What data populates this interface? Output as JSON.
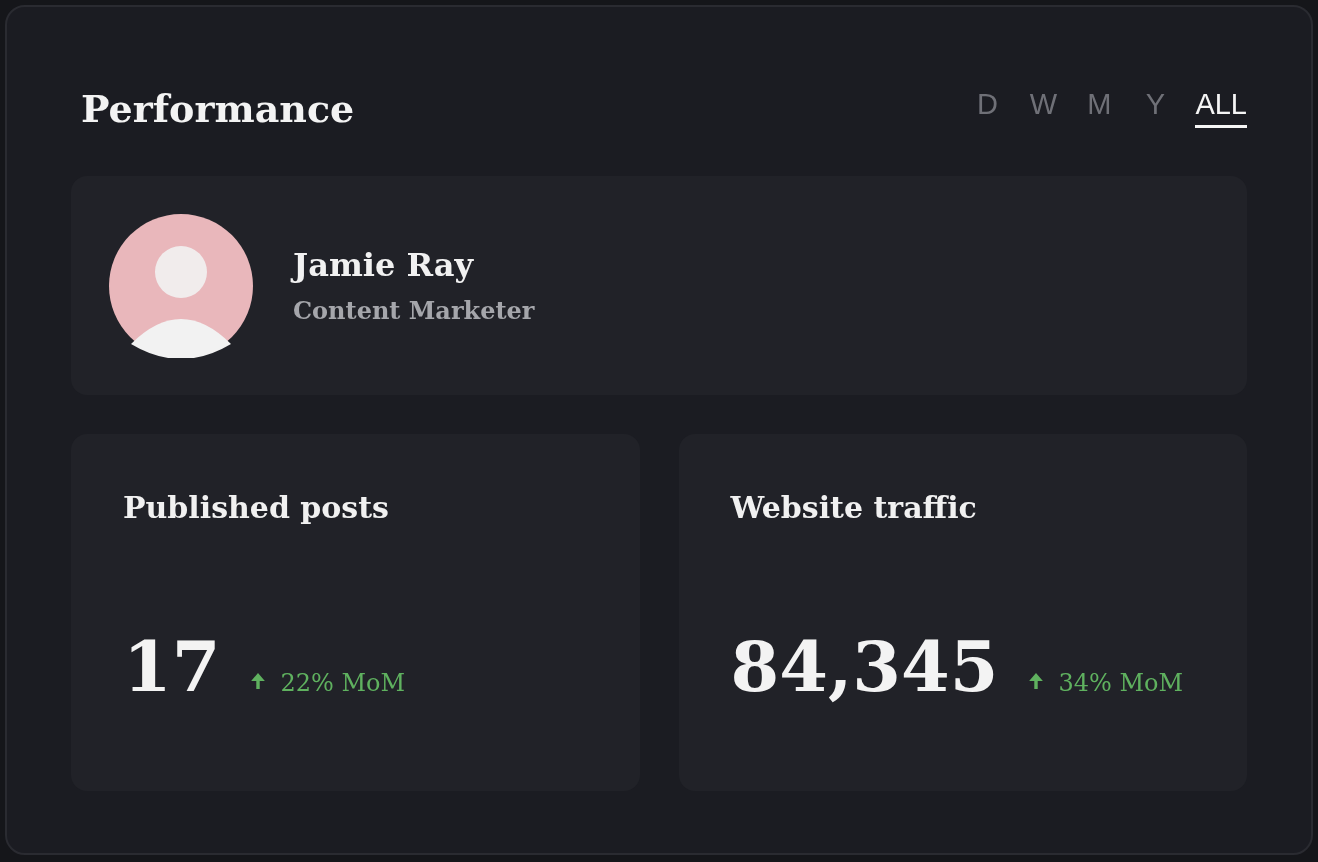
{
  "title": "Performance",
  "periods": [
    {
      "label": "D",
      "selected": false
    },
    {
      "label": "W",
      "selected": false
    },
    {
      "label": "M",
      "selected": false
    },
    {
      "label": "Y",
      "selected": false
    },
    {
      "label": "ALL",
      "selected": true
    }
  ],
  "profile": {
    "name": "Jamie Ray",
    "role": "Content Marketer"
  },
  "stats": [
    {
      "label": "Published posts",
      "value": "17",
      "kind": "rising",
      "change": "22% MoM"
    },
    {
      "label": "Website traffic",
      "value": "84,345",
      "kind": "rising",
      "change": "34% MoM"
    }
  ]
}
